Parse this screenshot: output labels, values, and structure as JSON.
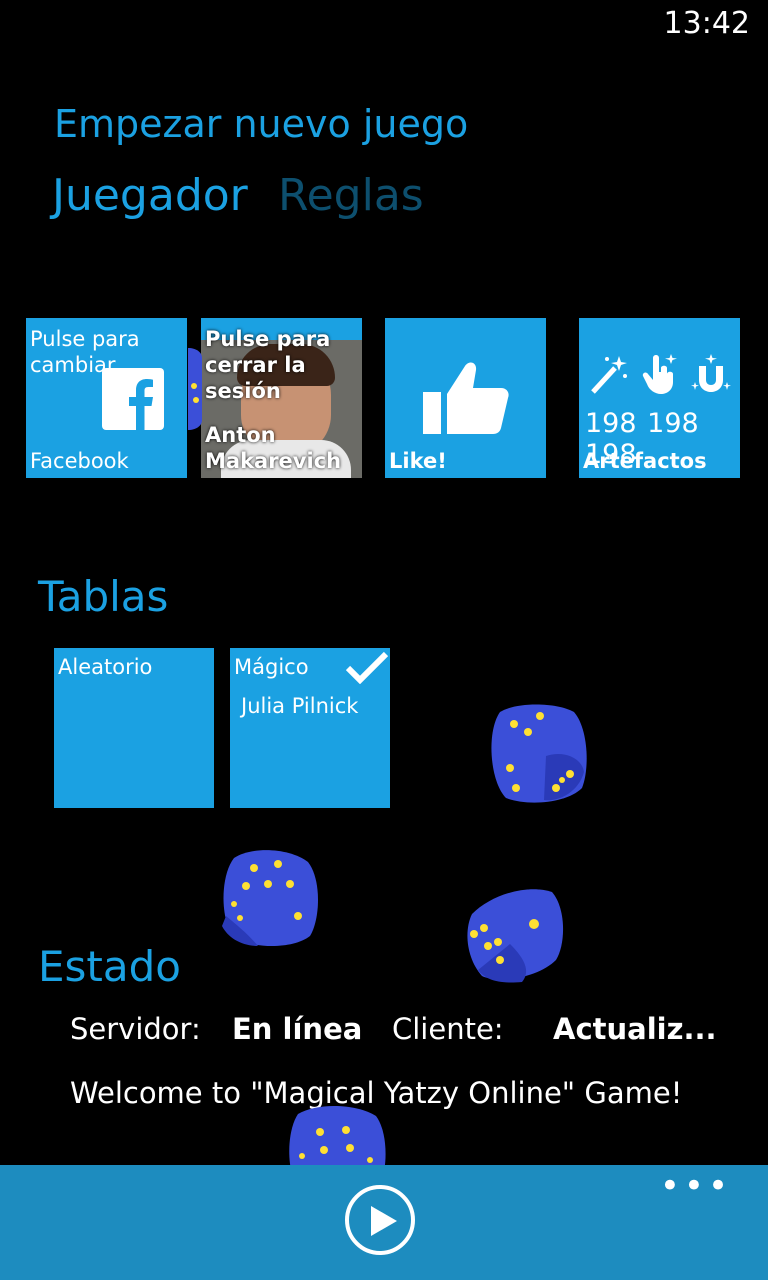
{
  "status_bar": {
    "time": "13:42"
  },
  "app": {
    "title": "Empezar nuevo juego"
  },
  "pivot": {
    "tabs": [
      {
        "label": "Juegador"
      },
      {
        "label": "Reglas"
      }
    ]
  },
  "tiles": {
    "facebook": {
      "top_text": "Pulse para cambiar",
      "label": "Facebook"
    },
    "profile": {
      "top_text": "Pulse para cerrar la sesión",
      "name": "Anton Makarevich"
    },
    "like": {
      "label": "Like!"
    },
    "artifacts": {
      "counts": [
        "198",
        "198",
        "198"
      ],
      "label": "Artefactos"
    }
  },
  "tables": {
    "title": "Tablas",
    "items": [
      {
        "label": "Aleatorio"
      },
      {
        "label": "Mágico",
        "owner": "Julia Pilnick"
      }
    ]
  },
  "state": {
    "title": "Estado",
    "server_label": "Servidor:",
    "server_value": "En línea",
    "client_label": "Cliente:",
    "client_value": "Actualiz...",
    "welcome": "Welcome to \"Magical Yatzy Online\" Game!"
  },
  "colors": {
    "accent": "#1ba1e2",
    "appbar": "#1d8cbf",
    "die": "#3b4fd8",
    "pip": "#ffe033"
  },
  "icons": [
    "facebook-icon",
    "like-thumb-icon",
    "magic-wand-icon",
    "tap-hand-icon",
    "magnet-icon",
    "play-icon",
    "checkmark-icon",
    "more-dots-icon"
  ]
}
